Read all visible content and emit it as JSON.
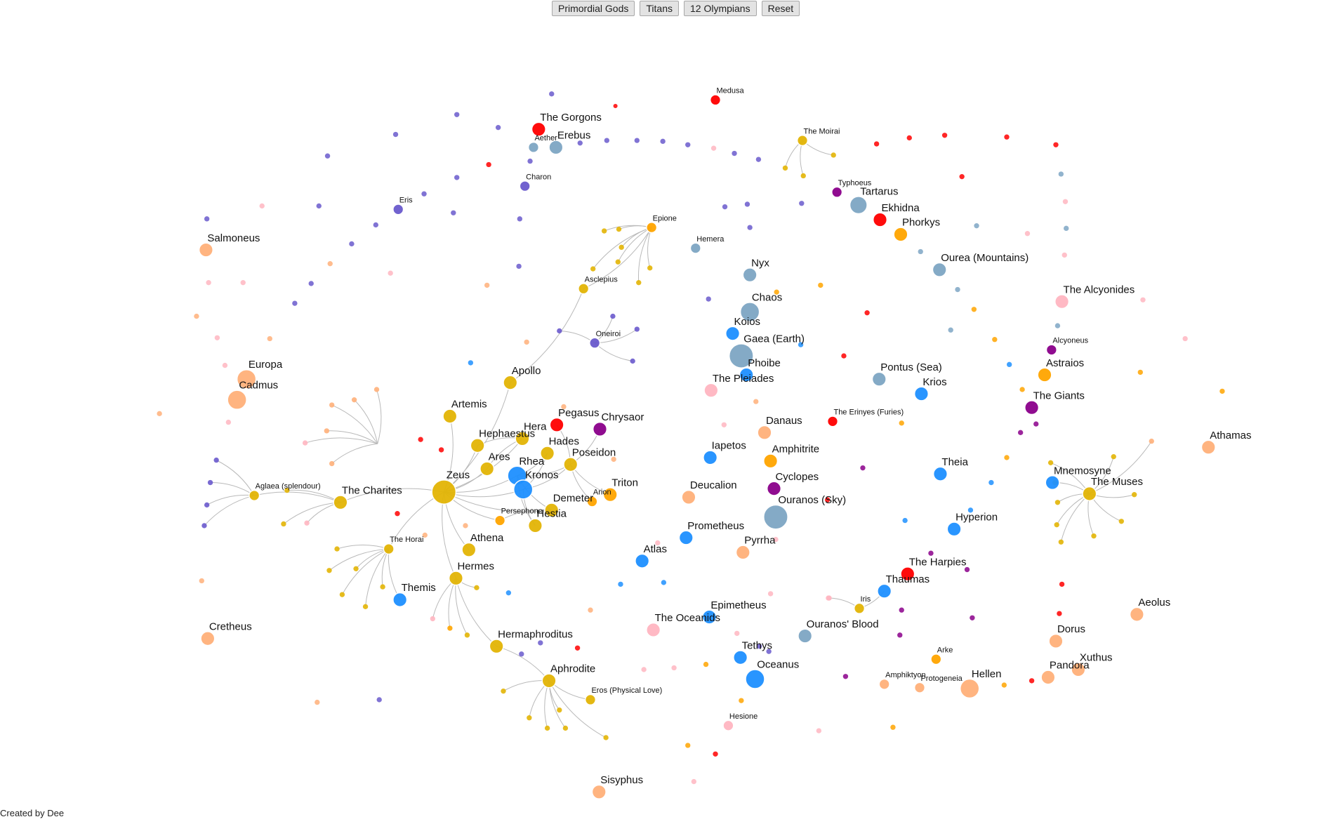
{
  "toolbar": {
    "buttons": [
      "Primordial Gods",
      "Titans",
      "12 Olympians",
      "Reset"
    ]
  },
  "footer": {
    "credit": "Created by Dee"
  },
  "colors": {
    "primordial": "#7ea6c4",
    "titan": "#1e90ff",
    "olympian": "#e3b506",
    "monster": "#ff0000",
    "creature": "#6a5acd",
    "giant": "#8b008b",
    "mortal": "#ffb07a",
    "nymph": "#ffb6c1",
    "minor": "#ffa500",
    "link": "#b9b9b9"
  },
  "labels": {
    "zeus": "Zeus",
    "hera": "Hera",
    "hephaestus": "Hephaestus",
    "ares": "Ares",
    "rhea": "Rhea",
    "kronos": "Kronos",
    "hades": "Hades",
    "poseidon": "Poseidon",
    "demeter": "Demeter",
    "hestia": "Hestia",
    "persephone": "Persephone",
    "athena": "Athena",
    "apollo": "Apollo",
    "artemis": "Artemis",
    "hermes": "Hermes",
    "hermaphroditus": "Hermaphroditus",
    "aphrodite": "Aphrodite",
    "eros": "Eros (Physical Love)",
    "charites": "The Charites",
    "aglaea": "Aglaea (splendour)",
    "horai": "The Horai",
    "themis": "Themis",
    "asclepius": "Asclepius",
    "epione": "Epione",
    "oneiroi": "Oneiroi",
    "pegasus": "Pegasus",
    "chrysaor": "Chrysaor",
    "triton": "Triton",
    "arion": "Arion",
    "gorgons": "The Gorgons",
    "aether": "Aether",
    "erebus": "Erebus",
    "charon": "Charon",
    "eris": "Eris",
    "medusa": "Medusa",
    "moirai": "The Moirai",
    "typhoeus": "Typhoeus",
    "tartarus": "Tartarus",
    "ekhidna": "Ekhidna",
    "phorkys": "Phorkys",
    "oureа": "Ourea (Mountains)",
    "hemera": "Hemera",
    "nyx": "Nyx",
    "chaos": "Chaos",
    "koios": "Koios",
    "gaea": "Gaea (Earth)",
    "phoibe": "Phoibe",
    "pleiades": "The Pleiades",
    "pontus": "Pontus (Sea)",
    "krios": "Krios",
    "alcyonides": "The Alcyonides",
    "alcyoneus": "Alcyoneus",
    "astraios": "Astraios",
    "giants": "The Giants",
    "danaus": "Danaus",
    "erinyes": "The Erinyes (Furies)",
    "iapetos": "Iapetos",
    "amphitrite": "Amphitrite",
    "cyclopes": "Cyclopes",
    "deucalion": "Deucalion",
    "ouranos": "Ouranos (Sky)",
    "theia": "Theia",
    "mnemosyne": "Mnemosyne",
    "muses": "The Muses",
    "athamas": "Athamas",
    "hyperion": "Hyperion",
    "prometheus": "Prometheus",
    "pyrrha": "Pyrrha",
    "atlas": "Atlas",
    "harpies": "The Harpies",
    "thaumas": "Thaumas",
    "epimetheus": "Epimetheus",
    "oceanids": "The Oceanids",
    "iris": "Iris",
    "ouranosblood": "Ouranos' Blood",
    "tethys": "Tethys",
    "oceanus": "Oceanus",
    "arke": "Arke",
    "amphiktyon": "Amphiktyon",
    "protogeneia": "Protogeneia",
    "hellen": "Hellen",
    "dorus": "Dorus",
    "pandora": "Pandora",
    "xuthus": "Xuthus",
    "aeolus": "Aeolus",
    "hesione": "Hesione",
    "sisyphus": "Sisyphus",
    "salmoneus": "Salmoneus",
    "europa": "Europa",
    "cadmus": "Cadmus",
    "cretheus": "Cretheus"
  }
}
